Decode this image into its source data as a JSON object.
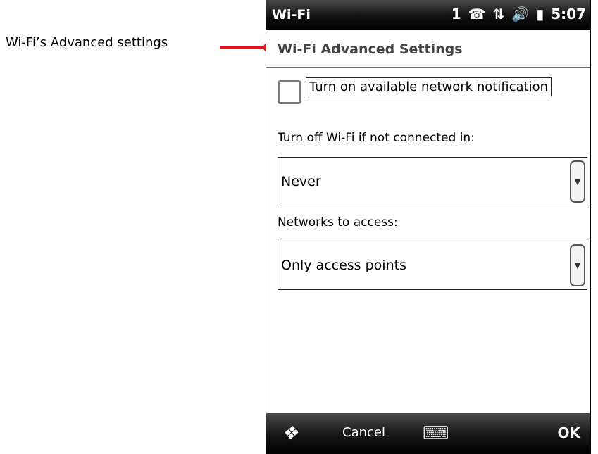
{
  "callout": {
    "text": "Wi-Fi’s Advanced settings",
    "color": "#e3141b"
  },
  "status_bar": {
    "title": "Wi-Fi",
    "signal_number": "1",
    "time": "5:07",
    "icons": [
      "signal-sync-icon",
      "network-icon",
      "speaker-icon",
      "battery-icon"
    ]
  },
  "page_title": "Wi-Fi Advanced Settings",
  "notification_checkbox": {
    "label": "Turn on available network notification",
    "checked": false
  },
  "wifi_timeout": {
    "label": "Turn off Wi-Fi if not connected in:",
    "value": "Never"
  },
  "networks_access": {
    "label": "Networks to access:",
    "value": "Only access points"
  },
  "soft_keys": {
    "left": "Cancel",
    "right": "OK",
    "icons": [
      "windows-start-icon",
      "keyboard-icon"
    ]
  }
}
